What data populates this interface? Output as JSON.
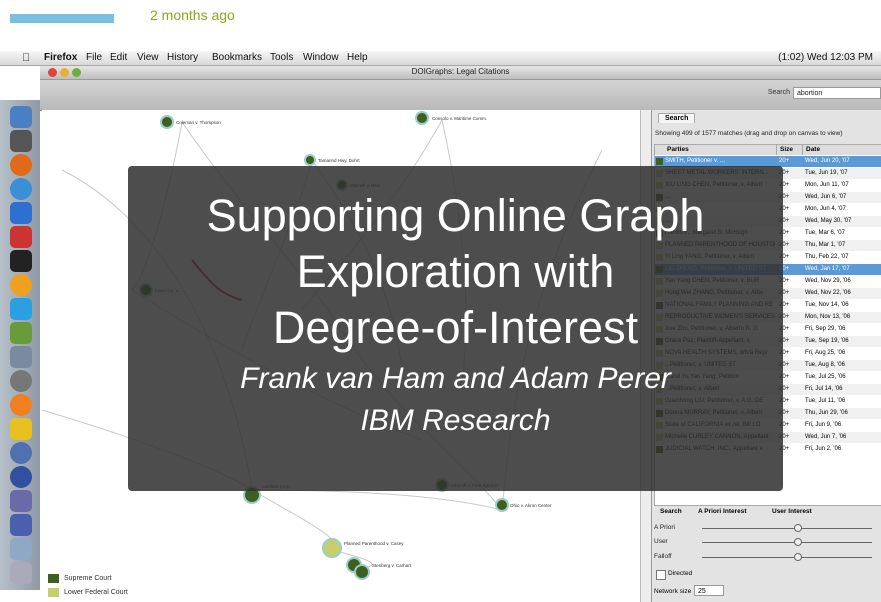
{
  "post": {
    "time": "2 months ago"
  },
  "menubar": {
    "app": "Firefox",
    "items": [
      "File",
      "Edit",
      "View",
      "History",
      "Bookmarks",
      "Tools",
      "Window",
      "Help"
    ],
    "status": "(1:02)   Wed 12:03 PM"
  },
  "window": {
    "title": "DOIGraphs: Legal Citations"
  },
  "toolbar": {
    "search_label": "Search",
    "search_value": "abortion"
  },
  "graph": {
    "nodes": [
      "Coleman v. Thompson",
      "Consolo v. Maritime Comm.",
      "Tamarind Hwy. Dohrt",
      "Mitchell v. Ham",
      "Jones Co. v. ...",
      "Lambert Corp.",
      "Ashcroft v. Free Speech",
      "Planned Parenthood v. Casey",
      "Stenberg v. Carhart",
      "Ohio v. Akron Center",
      "Lawrence v. Texas"
    ],
    "legend": [
      {
        "label": "Supreme Court",
        "color": "#3f5f1f"
      },
      {
        "label": "Lower Federal Court",
        "color": "#c8cf6a"
      }
    ]
  },
  "panel": {
    "tab": "Search",
    "match_text": "Showing 499 of 1577 matches (drag and drop on canvas to view)",
    "columns": [
      "Parties",
      "Size",
      "Date"
    ],
    "rows": [
      {
        "party": "SMITH, Petitioner v. ...",
        "size": "20+",
        "date": "Wed, Jun 20, '07",
        "sel": true
      },
      {
        "party": "SHEET METAL WORKERS' INTERN...",
        "size": "20+",
        "date": "Tue, Jun 19, '07"
      },
      {
        "party": "XIU LING CHEN, Petitioner, v. Albert",
        "size": "20+",
        "date": "Mon, Jun 11, '07"
      },
      {
        "party": "...",
        "size": "20+",
        "date": "Wed, Jun 6, '07"
      },
      {
        "party": "...",
        "size": "20+",
        "date": "Mon, Jun 4, '07"
      },
      {
        "party": "...",
        "size": "20+",
        "date": "Wed, May 30, '07"
      },
      {
        "party": "Harold F., Margaret B. McHugh",
        "size": "20+",
        "date": "Tue, Mar 6, '07"
      },
      {
        "party": "PLANNED PARENTHOOD OF HOUSTON",
        "size": "20+",
        "date": "Thu, Mar 1, '07"
      },
      {
        "party": "Yi Ling YANG, Petitioner, v. Albert",
        "size": "20+",
        "date": "Thu, Feb 22, '07"
      },
      {
        "party": "LIU ZHENG, Petitioner, v. UNITED ST",
        "size": "20+",
        "date": "Wed, Jan 17, '07",
        "sel": true
      },
      {
        "party": "Yan Yang CHEN, Petitioner, v. BUR",
        "size": "20+",
        "date": "Wed, Nov 29, '06"
      },
      {
        "party": "Hong Wei ZHANG, Petitioner, v. Albe",
        "size": "20+",
        "date": "Wed, Nov 22, '06"
      },
      {
        "party": "NATIONAL FAMILY PLANNING AND RE",
        "size": "20+",
        "date": "Tue, Nov 14, '06"
      },
      {
        "party": "REPRODUCTIVE WOMEN'S SERVICES",
        "size": "20+",
        "date": "Mon, Nov 13, '06"
      },
      {
        "party": "Xue Zhu, Petitioner, v. Alberto R. G",
        "size": "20+",
        "date": "Fri, Sep 29, '06"
      },
      {
        "party": "Grace Paz, Plaintiff-Appellant, v.",
        "size": "20+",
        "date": "Tue, Sep 19, '06"
      },
      {
        "party": "NOVA HEALTH SYSTEMS, d/b/a Repr",
        "size": "20+",
        "date": "Fri, Aug 25, '06"
      },
      {
        "party": "...Petitioner, v. UNITED ST",
        "size": "20+",
        "date": "Tue, Aug 8, '06"
      },
      {
        "party": "...and Yu Yan Yang, Petition",
        "size": "20+",
        "date": "Tue, Jul 25, '06"
      },
      {
        "party": "...Petitioner, v. Albert",
        "size": "20+",
        "date": "Fri, Jul 14, '06"
      },
      {
        "party": "Guanhong LIU, Petitioner, v. A.G. DE",
        "size": "20+",
        "date": "Tue, Jul 11, '06"
      },
      {
        "party": "Donna MURRAY, Petitioner, v. Albert",
        "size": "20+",
        "date": "Thu, Jun 29, '06"
      },
      {
        "party": "State of CALIFORNIA ex rel. Bill LO",
        "size": "20+",
        "date": "Fri, Jun 9, '06"
      },
      {
        "party": "Michelle CURLEY CANNON, Appellant",
        "size": "20+",
        "date": "Wed, Jun 7, '06"
      },
      {
        "party": "JUDICIAL WATCH, INC., Appellant v.",
        "size": "20+",
        "date": "Fri, Jun 2, '06"
      }
    ],
    "subtabs": [
      "Search",
      "A Priori Interest",
      "User Interest"
    ],
    "sliders": [
      "A Priori",
      "User",
      "Falloff"
    ],
    "directed_label": "Directed",
    "network_size_label": "Network size",
    "network_size_value": "25"
  },
  "overlay": {
    "title_lines": [
      "Supporting Online Graph",
      "Exploration with",
      "Degree-of-Interest"
    ],
    "authors": "Frank van Ham and Adam Perer",
    "organization": "IBM Research"
  }
}
